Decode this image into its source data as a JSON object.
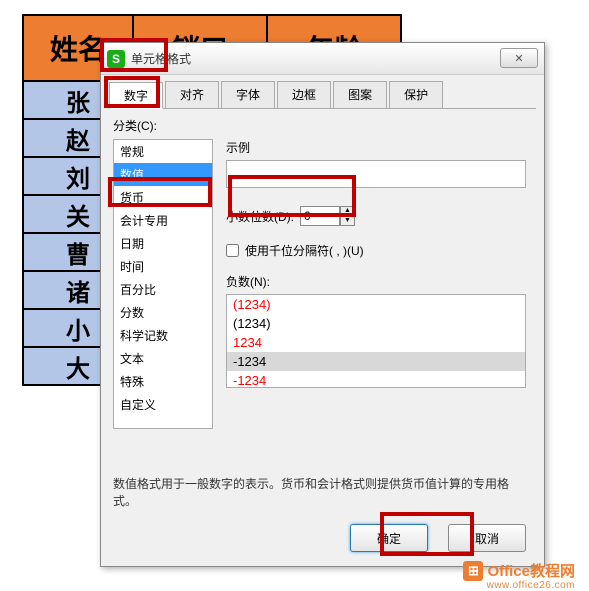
{
  "sheet": {
    "headers": [
      "姓名",
      "销口",
      "年龄"
    ],
    "rows": [
      "张",
      "赵",
      "刘",
      "关",
      "曹",
      "诸",
      "小",
      "大"
    ]
  },
  "dialog": {
    "title": "单元格格式",
    "close": "✕",
    "tabs": [
      "数字",
      "对齐",
      "字体",
      "边框",
      "图案",
      "保护"
    ],
    "category_label": "分类(C):",
    "categories": [
      "常规",
      "数值",
      "货币",
      "会计专用",
      "日期",
      "时间",
      "百分比",
      "分数",
      "科学记数",
      "文本",
      "特殊",
      "自定义"
    ],
    "selected_category_index": 1,
    "example_label": "示例",
    "decimal_label": "小数位数(D):",
    "decimal_value": "0",
    "thousand_label": "使用千位分隔符( , )(U)",
    "negative_label": "负数(N):",
    "negatives": [
      {
        "text": "(1234)",
        "cls": "neg-red"
      },
      {
        "text": "(1234)",
        "cls": "neg-black"
      },
      {
        "text": "1234",
        "cls": "neg-red"
      },
      {
        "text": "-1234",
        "cls": "neg-black neg-sel"
      },
      {
        "text": "-1234",
        "cls": "neg-red"
      }
    ],
    "description": "数值格式用于一般数字的表示。货币和会计格式则提供货币值计算的专用格式。",
    "ok": "确定",
    "cancel": "取消"
  },
  "watermark": {
    "text": "Office教程网",
    "sub": "www.office26.com"
  }
}
